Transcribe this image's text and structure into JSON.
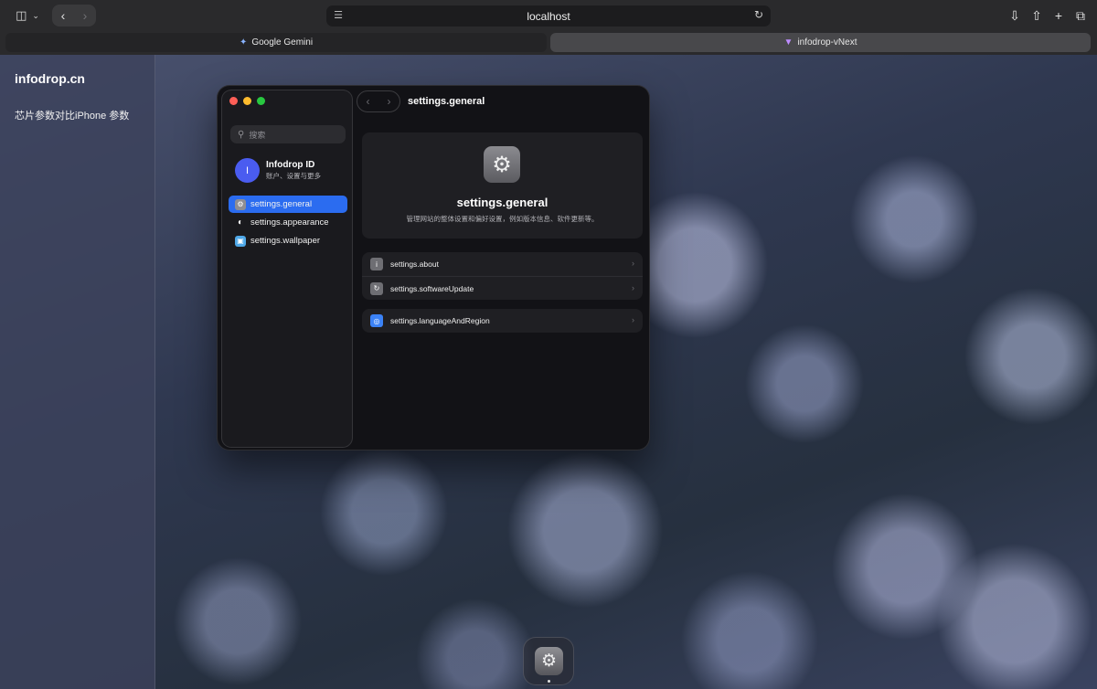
{
  "browser": {
    "address": "localhost",
    "tabs": [
      {
        "label": "Google Gemini",
        "icon": "gemini-sparkle-icon"
      },
      {
        "label": "infodrop-vNext",
        "icon": "vite-logo-icon"
      }
    ]
  },
  "page": {
    "brand": "infodrop.cn",
    "side_link": "芯片参数对比iPhone 参数"
  },
  "settings_window": {
    "search_placeholder": "搜索",
    "account": {
      "avatar_letter": "I",
      "name": "Infodrop ID",
      "subtitle": "账户、设置与更多"
    },
    "sidebar_items": [
      {
        "label": "settings.general",
        "icon": "gear-icon",
        "selected": true
      },
      {
        "label": "settings.appearance",
        "icon": "half-circle-icon",
        "selected": false
      },
      {
        "label": "settings.wallpaper",
        "icon": "wallpaper-icon",
        "selected": false
      }
    ],
    "header_title": "settings.general",
    "hero": {
      "title": "settings.general",
      "description": "管理网站的整体设置和偏好设置，例如版本信息、软件更新等。"
    },
    "group1": [
      {
        "label": "settings.about",
        "icon": "info-icon"
      },
      {
        "label": "settings.softwareUpdate",
        "icon": "update-icon"
      }
    ],
    "group2": [
      {
        "label": "settings.languageAndRegion",
        "icon": "globe-icon"
      }
    ]
  },
  "colors": {
    "accent": "#2b6cf0",
    "avatar": "#4a5cf0",
    "traffic_red": "#ff5f57",
    "traffic_yellow": "#febc2e",
    "traffic_green": "#28c840"
  }
}
